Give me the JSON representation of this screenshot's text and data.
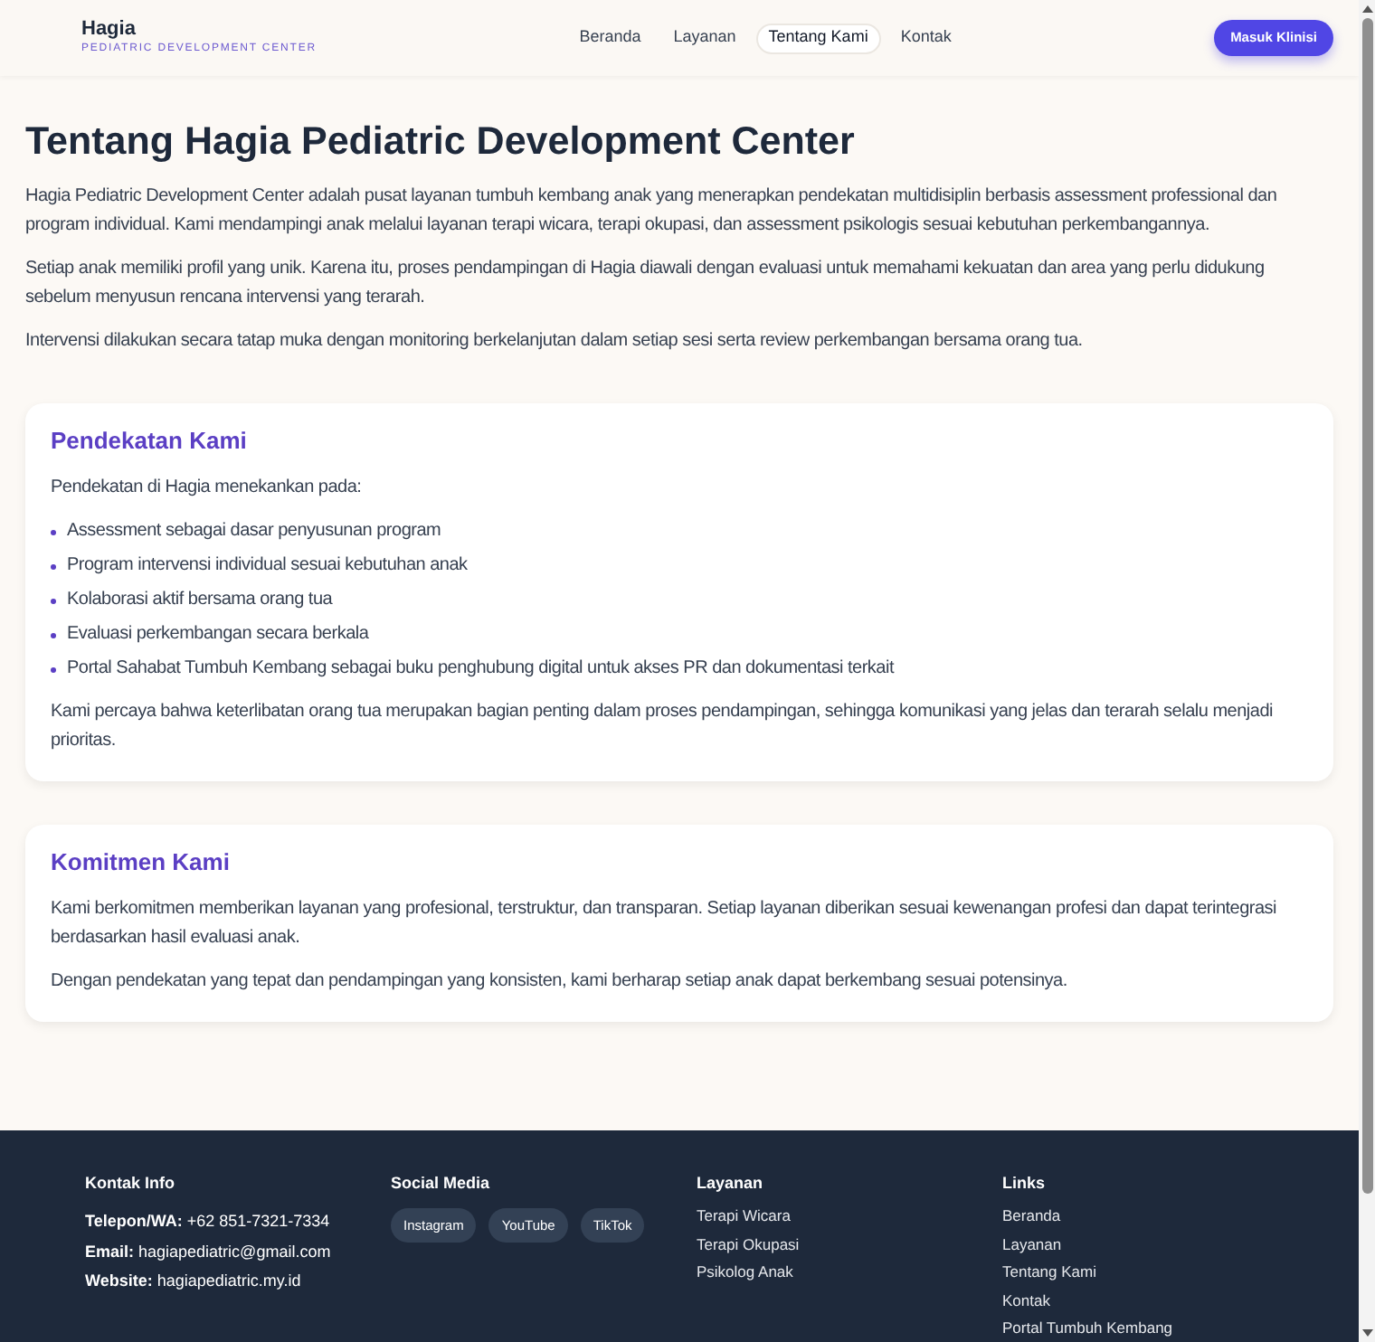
{
  "header": {
    "logo": {
      "name": "Hagia",
      "tagline": "PEDIATRIC DEVELOPMENT CENTER"
    },
    "nav": [
      {
        "label": "Beranda",
        "selected": false
      },
      {
        "label": "Layanan",
        "selected": false
      },
      {
        "label": "Tentang Kami",
        "selected": true
      },
      {
        "label": "Kontak",
        "selected": false
      }
    ],
    "cta": "Masuk Klinisi"
  },
  "page": {
    "title": "Tentang Hagia Pediatric Development Center",
    "paragraphs": [
      "Hagia Pediatric Development Center adalah pusat layanan tumbuh kembang anak yang menerapkan pendekatan multidisiplin berbasis assessment professional dan program individual. Kami mendampingi anak melalui layanan terapi wicara, terapi okupasi, dan assessment psikologis sesuai kebutuhan perkembangannya.",
      "Setiap anak memiliki profil yang unik. Karena itu, proses pendampingan di Hagia diawali dengan evaluasi untuk memahami kekuatan dan area yang perlu didukung sebelum menyusun rencana intervensi yang terarah.",
      "Intervensi dilakukan secara tatap muka dengan monitoring berkelanjutan dalam setiap sesi serta review perkembangan bersama orang tua."
    ]
  },
  "sections": [
    {
      "heading": "Pendekatan Kami",
      "blocks": [
        {
          "kind": "paragraph",
          "text": "Pendekatan di Hagia menekankan pada:"
        },
        {
          "kind": "list",
          "items": [
            "Assessment sebagai dasar penyusunan program",
            "Program intervensi individual sesuai kebutuhan anak",
            "Kolaborasi aktif bersama orang tua",
            "Evaluasi perkembangan secara berkala",
            "Portal Sahabat Tumbuh Kembang sebagai buku penghubung digital untuk akses PR dan dokumentasi terkait"
          ]
        },
        {
          "kind": "paragraph",
          "text": "Kami percaya bahwa keterlibatan orang tua merupakan bagian penting dalam proses pendampingan, sehingga komunikasi yang jelas dan terarah selalu menjadi prioritas."
        }
      ]
    },
    {
      "heading": "Komitmen Kami",
      "blocks": [
        {
          "kind": "paragraph",
          "text": "Kami berkomitmen memberikan layanan yang profesional, terstruktur, dan transparan. Setiap layanan diberikan sesuai kewenangan profesi dan dapat terintegrasi berdasarkan hasil evaluasi anak."
        },
        {
          "kind": "paragraph",
          "text": "Dengan pendekatan yang tepat dan pendampingan yang konsisten, kami berharap setiap anak dapat berkembang sesuai potensinya."
        }
      ]
    }
  ],
  "footer": {
    "columns": [
      {
        "heading": "Kontak Info",
        "kind": "contacts",
        "items": [
          "**Telepon/WA:** +62 851-7321-7334",
          "**Email:** hagiapediatric@gmail.com",
          "**Website:** hagiapediatric.my.id"
        ]
      },
      {
        "heading": "Social Media",
        "kind": "pills",
        "items": [
          "Instagram",
          "YouTube",
          "TikTok"
        ]
      },
      {
        "heading": "Layanan",
        "kind": "links",
        "items": [
          "Terapi Wicara",
          "Terapi Okupasi",
          "Psikolog Anak"
        ]
      },
      {
        "heading": "Links",
        "kind": "links",
        "items": [
          "Beranda",
          "Layanan",
          "Tentang Kami",
          "Kontak",
          "Portal Tumbuh Kembang"
        ]
      }
    ]
  }
}
